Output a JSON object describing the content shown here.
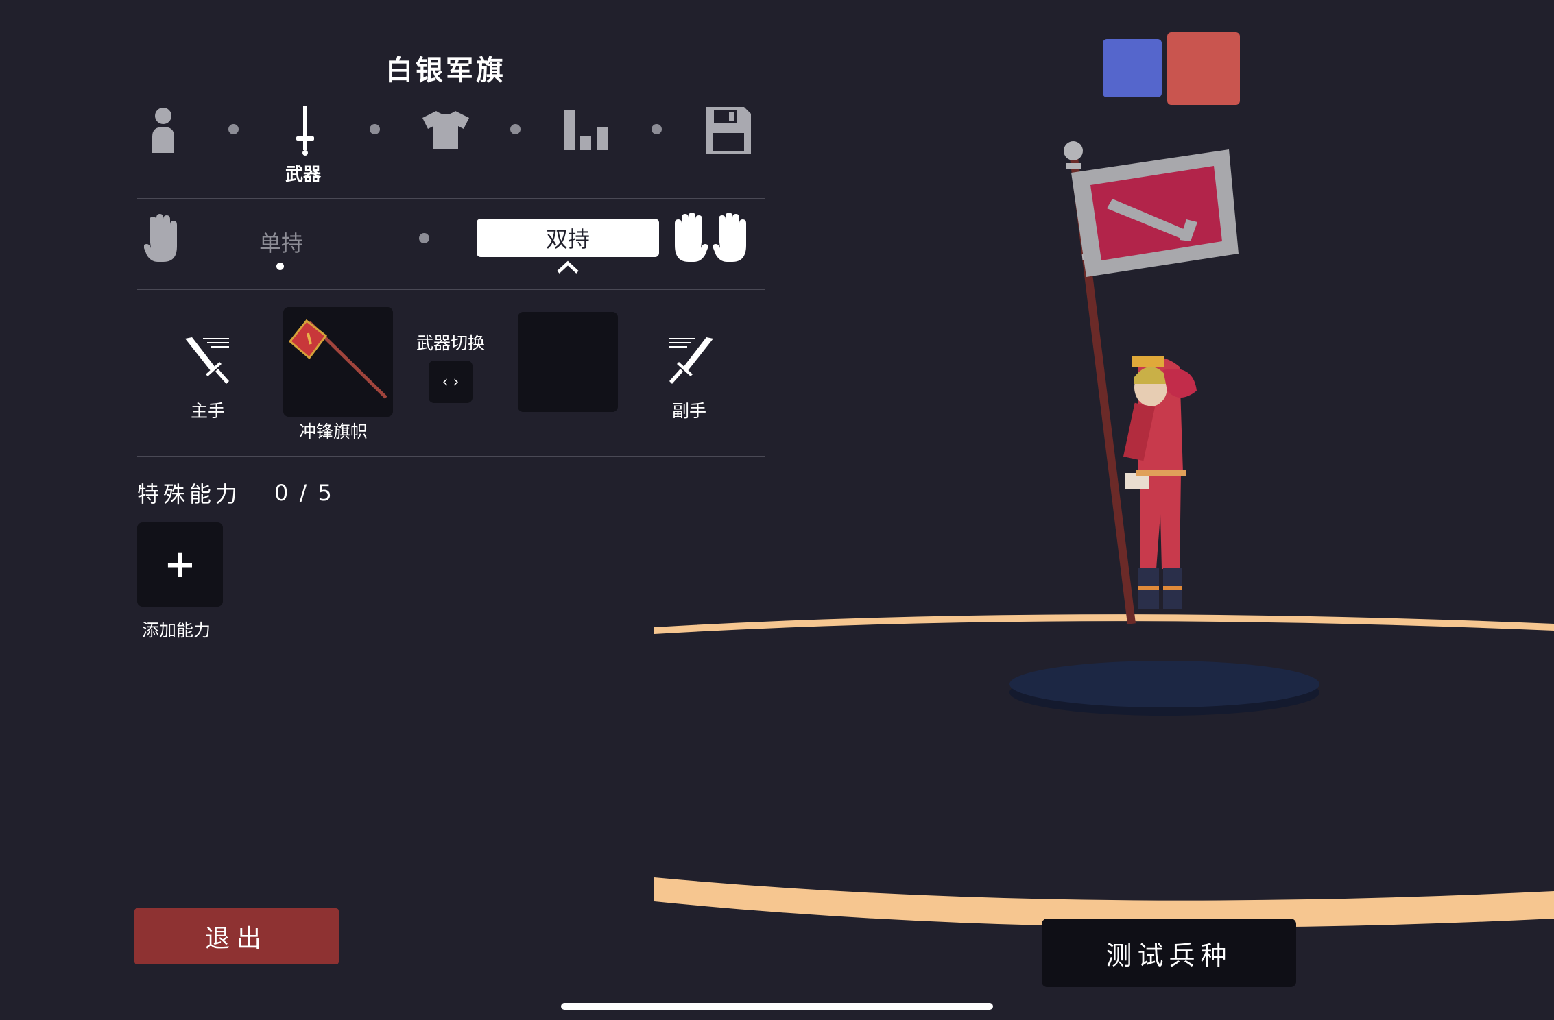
{
  "unit_title": "白银军旗",
  "tabs": [
    {
      "id": "body",
      "icon": "person-icon",
      "label": ""
    },
    {
      "id": "weapon",
      "icon": "sword-icon",
      "label": "武器",
      "active": true
    },
    {
      "id": "clothing",
      "icon": "shirt-icon",
      "label": ""
    },
    {
      "id": "stats",
      "icon": "bar-chart-icon",
      "label": ""
    },
    {
      "id": "save",
      "icon": "floppy-disk-icon",
      "label": ""
    }
  ],
  "grip": {
    "single_label": "单持",
    "dual_label": "双持",
    "selected": "双持"
  },
  "weapons": {
    "main_hand_label": "主手",
    "main_weapon_name": "冲锋旗帜",
    "swap_label": "武器切换",
    "swap_symbol": "‹ ›",
    "off_hand_label": "副手"
  },
  "abilities": {
    "heading": "特殊能力",
    "count": "0 / 5",
    "add_symbol": "+",
    "add_label": "添加能力"
  },
  "buttons": {
    "exit": "退出",
    "test": "测试兵种"
  },
  "team_colors": {
    "blue": "#5566cc",
    "red": "#c9554f"
  }
}
